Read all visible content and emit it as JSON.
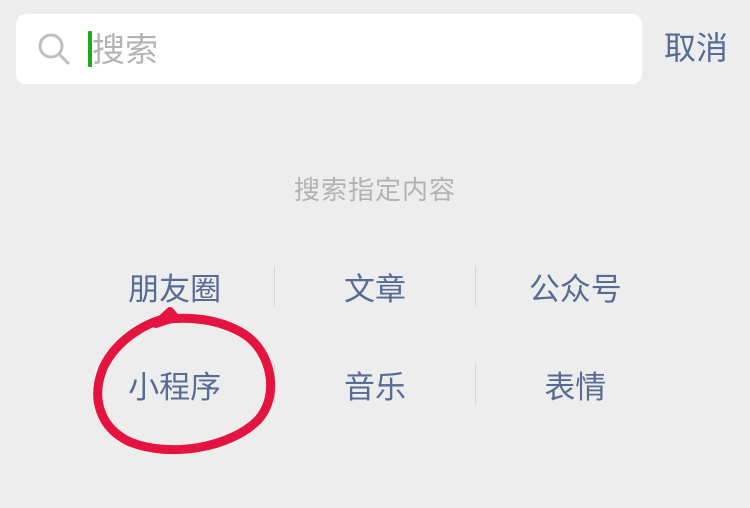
{
  "search": {
    "placeholder": "搜索",
    "value": "",
    "cancel_label": "取消"
  },
  "content_filter": {
    "title": "搜索指定内容",
    "rows": [
      [
        "朋友圈",
        "文章",
        "公众号"
      ],
      [
        "小程序",
        "音乐",
        "表情"
      ]
    ]
  },
  "colors": {
    "background": "#ededed",
    "link": "#576b95",
    "caret": "#1aad19",
    "annotation": "#e4143f"
  },
  "icons": {
    "search": "search-icon"
  }
}
